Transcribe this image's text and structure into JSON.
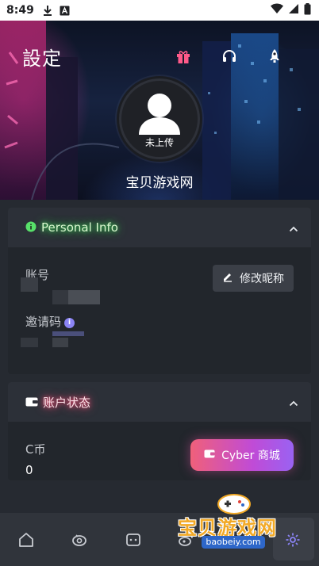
{
  "status_bar": {
    "time": "8:49",
    "icons": [
      "download-icon",
      "a-icon",
      "wifi-icon",
      "signal-icon",
      "battery-icon"
    ]
  },
  "header": {
    "title": "設定",
    "icons": [
      "gift-icon",
      "headset-icon",
      "rocket-icon"
    ],
    "avatar_label": "未上传",
    "site_name": "宝贝游戏网"
  },
  "personal_info": {
    "title": "Personal Info",
    "account_label": "账号",
    "invite_code_label": "邀请码",
    "edit_nickname_label": "修改昵称"
  },
  "account_status": {
    "title": "账户状态",
    "coin_label": "C币",
    "coin_value": "0",
    "cyber_button_label": "Cyber 商城"
  },
  "bottom_nav": {
    "items": [
      "home-icon",
      "eye-icon",
      "chat-icon",
      "weibo-icon",
      "settings-icon"
    ],
    "active": "settings-icon"
  },
  "watermark": {
    "text": "宝贝游戏网",
    "url": "baobeiy.com"
  },
  "colors": {
    "personal_glow": "#39d353",
    "status_glow": "#ff4f78",
    "accent_purple": "#8b84f6",
    "cyber_gradient": [
      "#f0607a",
      "#9a62f2"
    ]
  }
}
